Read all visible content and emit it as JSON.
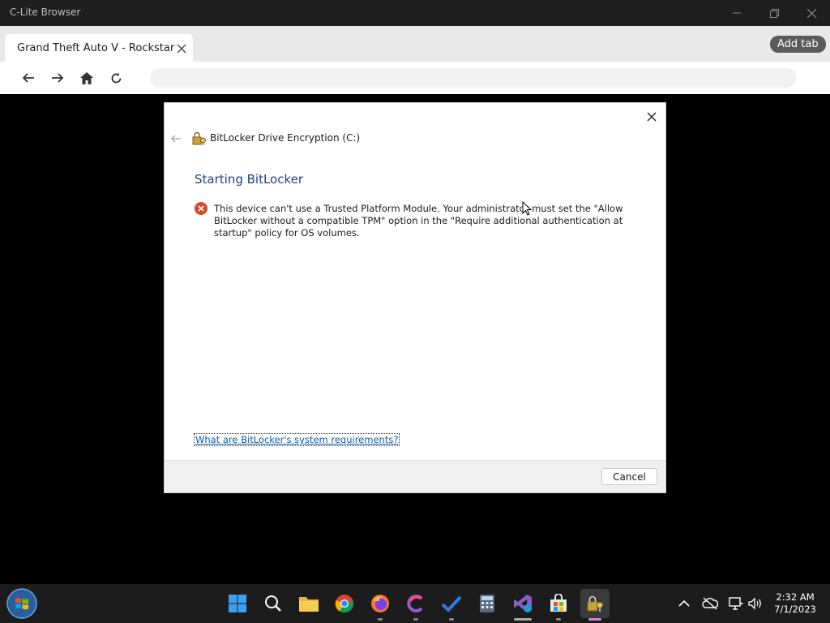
{
  "browser": {
    "app_title": "C-Lite Browser",
    "tab_title": "Grand Theft Auto V - Rockstar Ga",
    "add_tab_label": "Add tab",
    "url_value": ""
  },
  "dialog": {
    "window_title": "BitLocker Drive Encryption (C:)",
    "heading": "Starting BitLocker",
    "error_message": "This device can't use a Trusted Platform Module. Your administrator must set the \"Allow BitLocker without a compatible TPM\" option in the \"Require additional authentication at startup\" policy for OS volumes.",
    "requirements_link": "What are BitLocker's system requirements?",
    "cancel_label": "Cancel"
  },
  "taskbar": {
    "apps": [
      "windows-start-icon",
      "search-icon",
      "file-explorer-icon",
      "chrome-icon",
      "firefox-icon",
      "browser-c-icon",
      "todo-icon",
      "calculator-icon",
      "visual-studio-icon",
      "store-icon",
      "bitlocker-icon"
    ],
    "clock": {
      "time": "2:32 AM",
      "date": "7/1/2023"
    }
  },
  "colors": {
    "accent_heading": "#1e3f8a",
    "link": "#0b5cad",
    "error": "#d8492c"
  }
}
